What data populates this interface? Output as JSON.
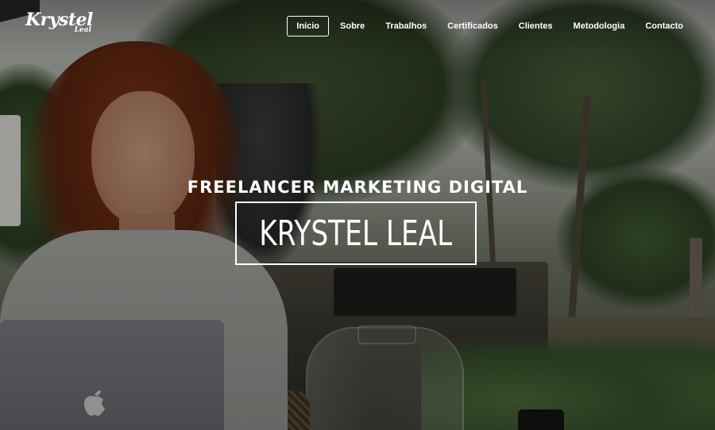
{
  "brand": {
    "logo_line1": "Krystel",
    "logo_line2": "Leal"
  },
  "nav": {
    "items": [
      {
        "label": "Início",
        "active": true
      },
      {
        "label": "Sobre",
        "active": false
      },
      {
        "label": "Trabalhos",
        "active": false
      },
      {
        "label": "Certificados",
        "active": false
      },
      {
        "label": "Clientes",
        "active": false
      },
      {
        "label": "Metodologia",
        "active": false
      },
      {
        "label": "Contacto",
        "active": false
      }
    ]
  },
  "hero": {
    "tagline": "FREELANCER MARKETING DIGITAL",
    "name": "KRYSTEL LEAL"
  },
  "colors": {
    "text": "#ffffff",
    "overlay": "rgba(0,0,0,0.28)"
  },
  "icons": {
    "laptop_logo": "apple-logo-icon"
  }
}
